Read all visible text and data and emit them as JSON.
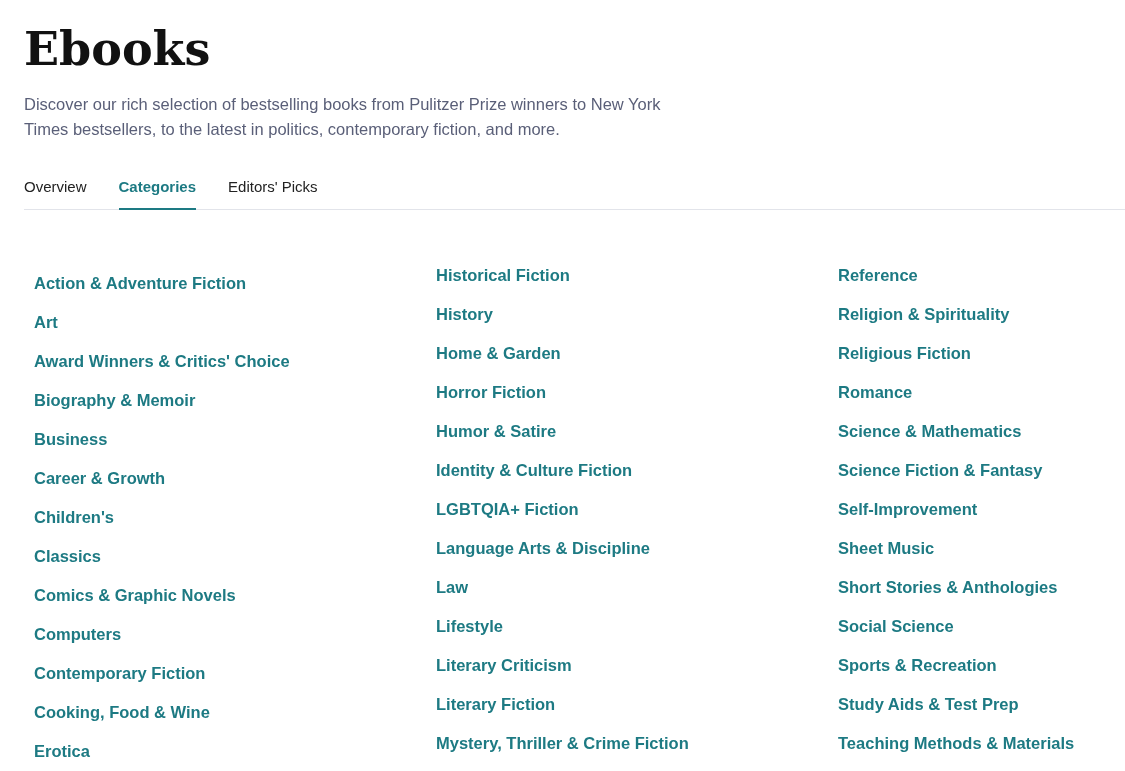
{
  "title": "Ebooks",
  "description": "Discover our rich selection of bestselling books from Pulitzer Prize winners to New York Times bestsellers, to the latest in politics, contemporary fiction, and more.",
  "tabs": [
    {
      "label": "Overview",
      "selected": false
    },
    {
      "label": "Categories",
      "selected": true
    },
    {
      "label": "Editors' Picks",
      "selected": false
    }
  ],
  "categories": [
    [
      "Action & Adventure Fiction",
      "Art",
      "Award Winners & Critics' Choice",
      "Biography & Memoir",
      "Business",
      "Career & Growth",
      "Children's",
      "Classics",
      "Comics & Graphic Novels",
      "Computers",
      "Contemporary Fiction",
      "Cooking, Food & Wine",
      "Erotica"
    ],
    [
      "Historical Fiction",
      "History",
      "Home & Garden",
      "Horror Fiction",
      "Humor & Satire",
      "Identity & Culture Fiction",
      "LGBTQIA+ Fiction",
      "Language Arts & Discipline",
      "Law",
      "Lifestyle",
      "Literary Criticism",
      "Literary Fiction",
      "Mystery, Thriller & Crime Fiction"
    ],
    [
      "Reference",
      "Religion & Spirituality",
      "Religious Fiction",
      "Romance",
      "Science & Mathematics",
      "Science Fiction & Fantasy",
      "Self-Improvement",
      "Sheet Music",
      "Short Stories & Anthologies",
      "Social Science",
      "Sports & Recreation",
      "Study Aids & Test Prep",
      "Teaching Methods & Materials"
    ]
  ]
}
